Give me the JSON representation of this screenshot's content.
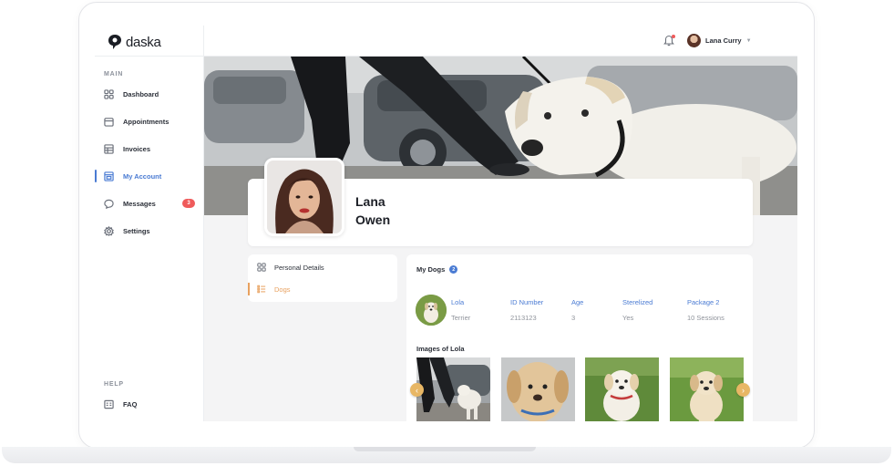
{
  "app": {
    "logo_text": "daska"
  },
  "sidebar": {
    "main_label": "MAIN",
    "items": [
      {
        "label": "Dashboard",
        "icon": "grid-icon"
      },
      {
        "label": "Appointments",
        "icon": "calendar-icon"
      },
      {
        "label": "Invoices",
        "icon": "invoice-icon"
      },
      {
        "label": "My Account",
        "icon": "account-icon",
        "active": true
      },
      {
        "label": "Messages",
        "icon": "message-icon",
        "badge": "3"
      },
      {
        "label": "Settings",
        "icon": "gear-icon"
      }
    ],
    "help_label": "HELP",
    "help_items": [
      {
        "label": "FAQ",
        "icon": "faq-icon"
      }
    ]
  },
  "topbar": {
    "user_name": "Lana Curry"
  },
  "profile": {
    "first_name": "Lana",
    "last_name": "Owen"
  },
  "tabs": [
    {
      "label": "Personal Details",
      "icon": "grid-icon"
    },
    {
      "label": "Dogs",
      "icon": "list-icon",
      "active": true
    }
  ],
  "dogs": {
    "title": "My Dogs",
    "count": "2",
    "columns": [
      {
        "header": "Lola",
        "value": "Terrier"
      },
      {
        "header": "ID Number",
        "value": "2113123"
      },
      {
        "header": "Age",
        "value": "3"
      },
      {
        "header": "Sterelized",
        "value": "Yes"
      },
      {
        "header": "Package 2",
        "value": "10 Sessions"
      }
    ],
    "images_title": "Images of Lola"
  },
  "colors": {
    "accent": "#4a7bd3",
    "orange": "#e8a15f",
    "badge": "#ef5b5b",
    "carousel": "#e8b765"
  }
}
